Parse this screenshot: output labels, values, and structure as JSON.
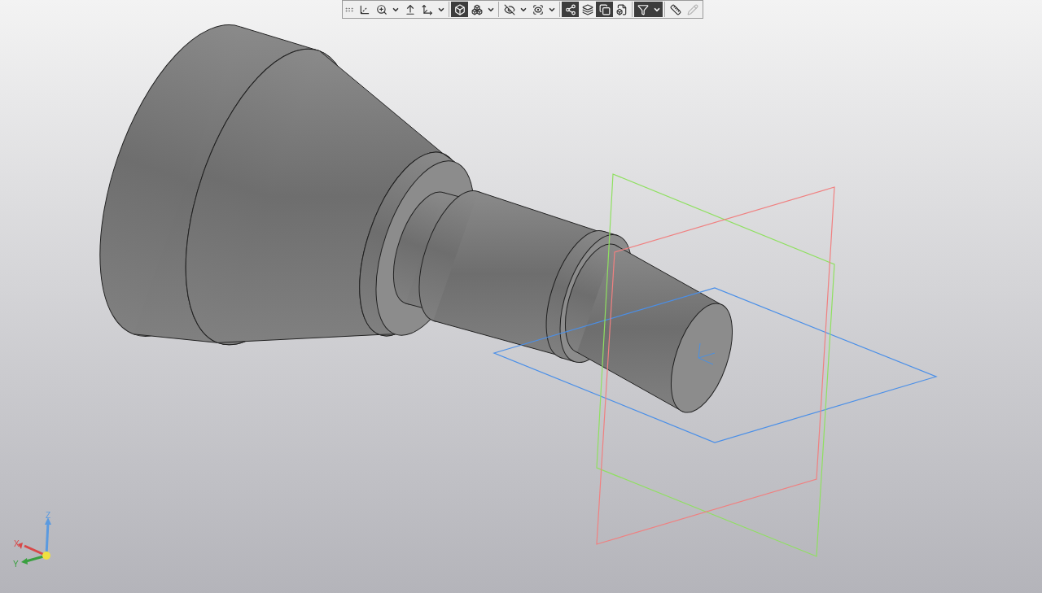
{
  "toolbar": {
    "buttons": [
      {
        "selected": false,
        "disabled": false,
        "dropdown": false
      },
      {
        "selected": false,
        "disabled": false,
        "dropdown": true
      },
      {
        "selected": false,
        "disabled": false,
        "dropdown": false
      },
      {
        "selected": false,
        "disabled": false,
        "dropdown": true
      },
      {
        "selected": true,
        "disabled": false,
        "dropdown": false
      },
      {
        "selected": false,
        "disabled": false,
        "dropdown": true
      },
      {
        "selected": false,
        "disabled": false,
        "dropdown": true
      },
      {
        "selected": false,
        "disabled": false,
        "dropdown": true
      },
      {
        "selected": true,
        "disabled": false,
        "dropdown": false
      },
      {
        "selected": false,
        "disabled": false,
        "dropdown": false
      },
      {
        "selected": true,
        "disabled": false,
        "dropdown": false
      },
      {
        "selected": false,
        "disabled": false,
        "dropdown": false
      },
      {
        "selected": true,
        "disabled": false,
        "dropdown": true
      },
      {
        "selected": false,
        "disabled": false,
        "dropdown": false
      },
      {
        "selected": false,
        "disabled": true,
        "dropdown": false
      }
    ]
  },
  "axis_triad": {
    "labels": [
      "X",
      "Y",
      "Z"
    ]
  }
}
